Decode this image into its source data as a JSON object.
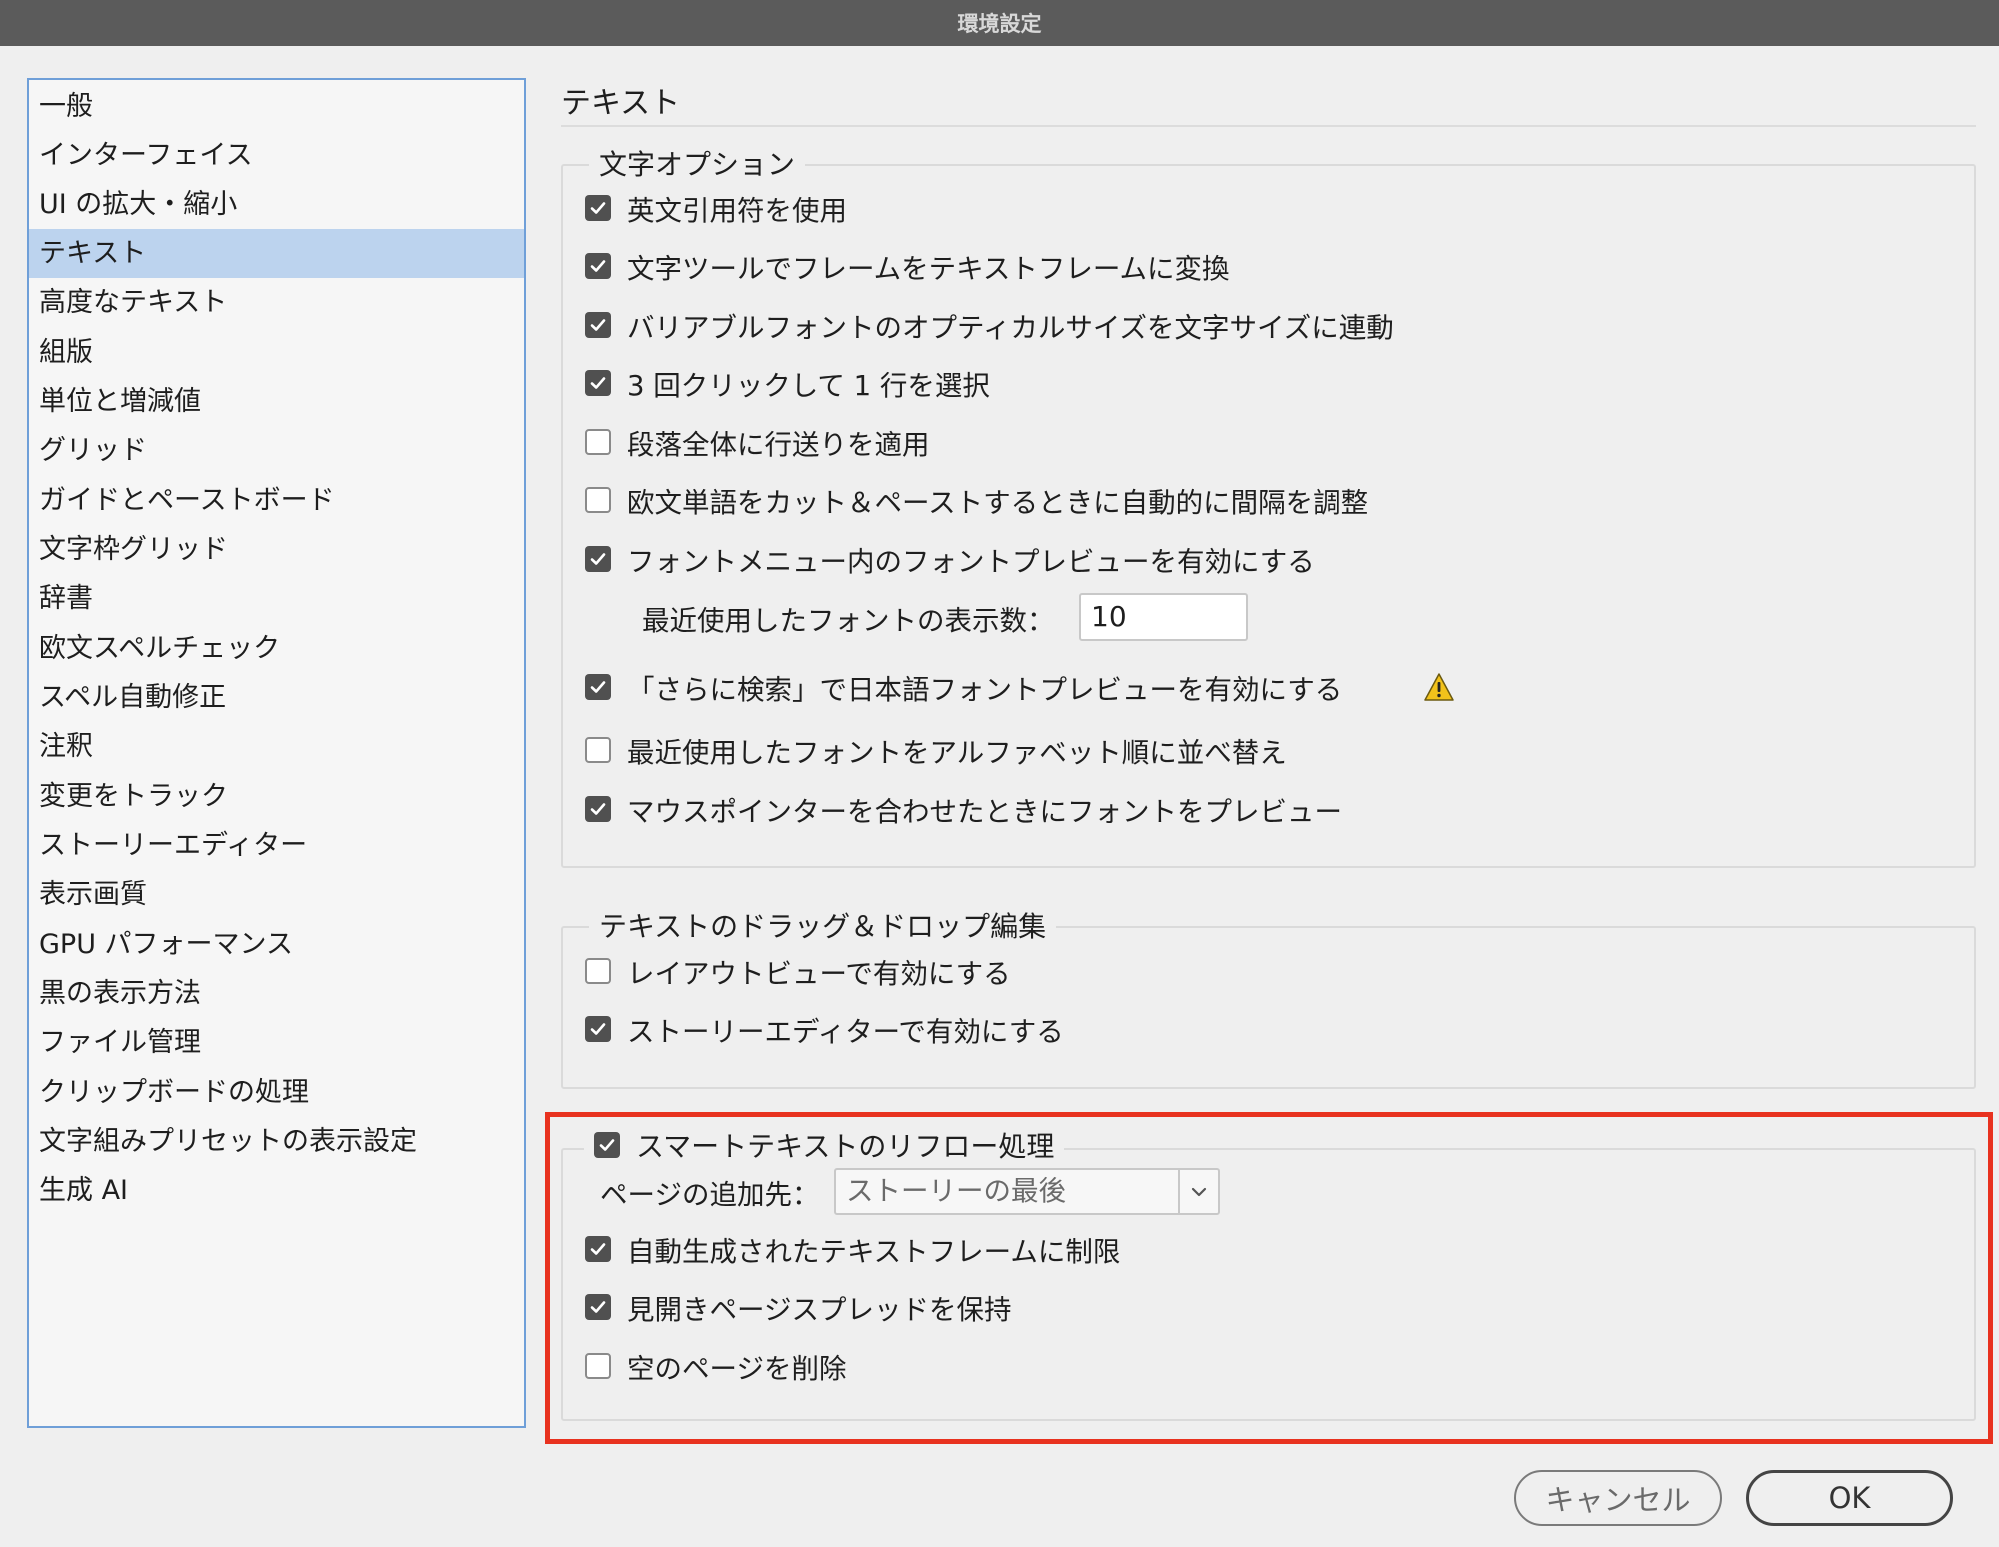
{
  "window": {
    "title": "環境設定"
  },
  "sidebar": {
    "items": [
      {
        "label": "一般"
      },
      {
        "label": "インターフェイス"
      },
      {
        "label": "UI の拡大・縮小"
      },
      {
        "label": "テキスト",
        "selected": true
      },
      {
        "label": "高度なテキスト"
      },
      {
        "label": "組版"
      },
      {
        "label": "単位と増減値"
      },
      {
        "label": "グリッド"
      },
      {
        "label": "ガイドとペーストボード"
      },
      {
        "label": "文字枠グリッド"
      },
      {
        "label": "辞書"
      },
      {
        "label": "欧文スペルチェック"
      },
      {
        "label": "スペル自動修正"
      },
      {
        "label": "注釈"
      },
      {
        "label": "変更をトラック"
      },
      {
        "label": "ストーリーエディター"
      },
      {
        "label": "表示画質"
      },
      {
        "label": "GPU パフォーマンス"
      },
      {
        "label": "黒の表示方法"
      },
      {
        "label": "ファイル管理"
      },
      {
        "label": "クリップボードの処理"
      },
      {
        "label": "文字組みプリセットの表示設定"
      },
      {
        "label": "生成 AI"
      }
    ]
  },
  "main": {
    "title": "テキスト",
    "char_options": {
      "legend": "文字オプション",
      "items": [
        {
          "label": "英文引用符を使用",
          "checked": true
        },
        {
          "label": "文字ツールでフレームをテキストフレームに変換",
          "checked": true
        },
        {
          "label": "バリアブルフォントのオプティカルサイズを文字サイズに連動",
          "checked": true
        },
        {
          "label": "3 回クリックして 1 行を選択",
          "checked": true
        },
        {
          "label": "段落全体に行送りを適用",
          "checked": false
        },
        {
          "label": "欧文単語をカット＆ペーストするときに自動的に間隔を調整",
          "checked": false
        },
        {
          "label": "フォントメニュー内のフォントプレビューを有効にする",
          "checked": true
        }
      ],
      "recent_fonts_label": "最近使用したフォントの表示数：",
      "recent_fonts_value": "10",
      "items2": [
        {
          "label": "「さらに検索」で日本語フォントプレビューを有効にする",
          "checked": true,
          "icon": "warning-icon"
        },
        {
          "label": "最近使用したフォントをアルファベット順に並べ替え",
          "checked": false
        },
        {
          "label": "マウスポインターを合わせたときにフォントをプレビュー",
          "checked": true
        }
      ]
    },
    "drag_drop": {
      "legend": "テキストのドラッグ＆ドロップ編集",
      "items": [
        {
          "label": "レイアウトビューで有効にする",
          "checked": false
        },
        {
          "label": "ストーリーエディターで有効にする",
          "checked": true
        }
      ]
    },
    "smart_reflow": {
      "label": "スマートテキストのリフロー処理",
      "checked": true,
      "add_pages_label": "ページの追加先：",
      "add_pages_value": "ストーリーの最後",
      "items": [
        {
          "label": "自動生成されたテキストフレームに制限",
          "checked": true
        },
        {
          "label": "見開きページスプレッドを保持",
          "checked": true
        },
        {
          "label": "空のページを削除",
          "checked": false
        }
      ]
    }
  },
  "footer": {
    "cancel_label": "キャンセル",
    "ok_label": "OK"
  },
  "colors": {
    "highlight": "#e8321f",
    "selection": "#bcd3ee",
    "checkbox": "#505050",
    "warning": "#f2c21b"
  }
}
